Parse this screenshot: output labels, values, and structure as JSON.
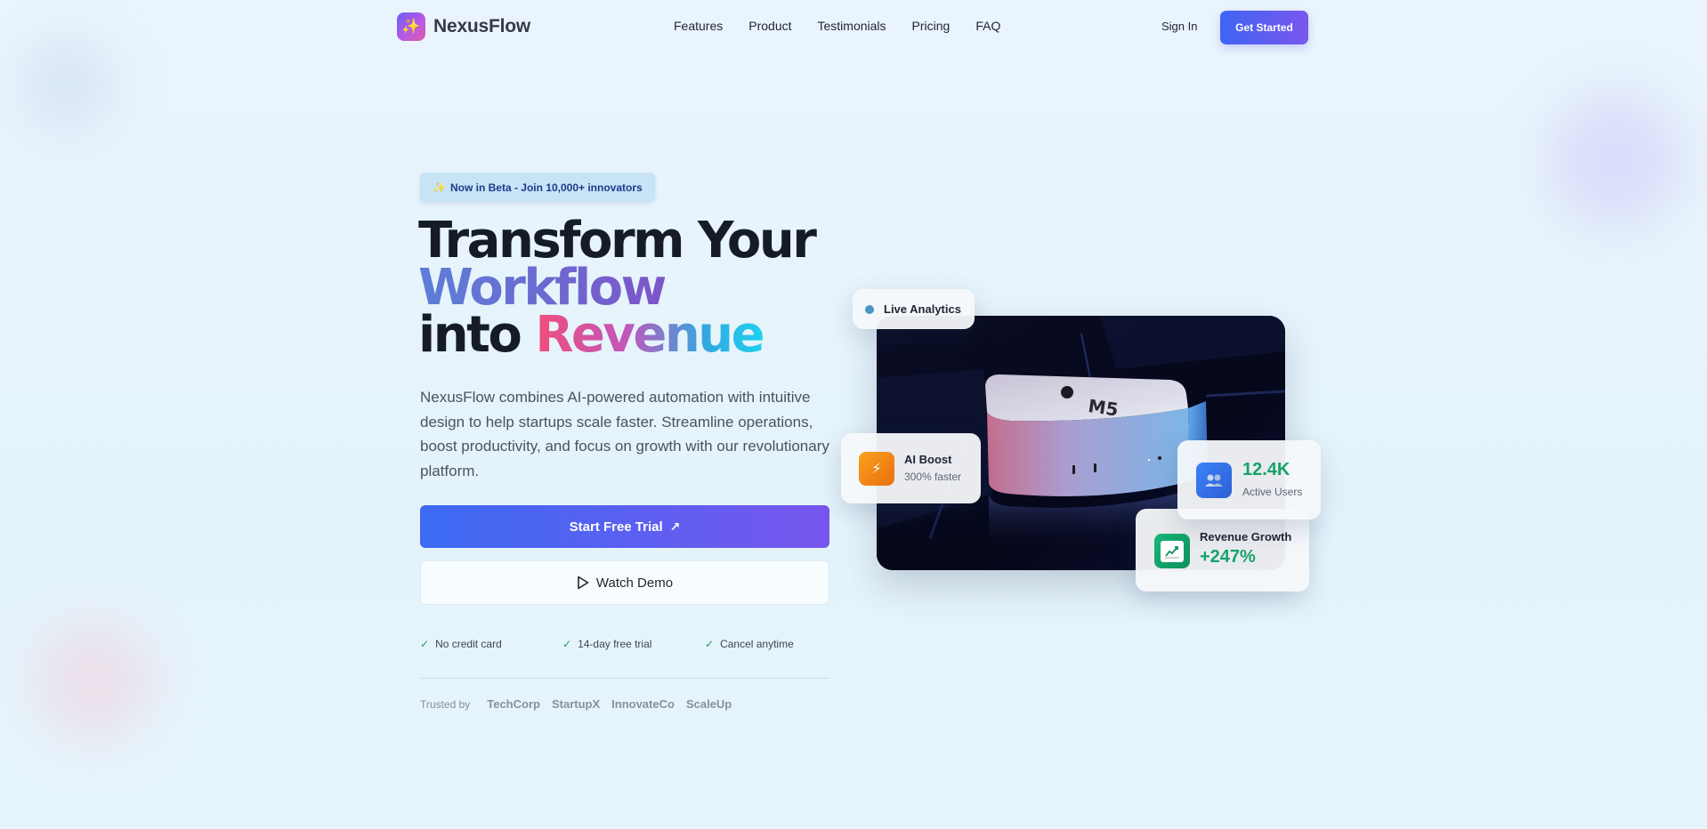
{
  "brand": {
    "name": "NexusFlow",
    "logo_icon": "sparkles-icon",
    "accent_color": "#4f63f0"
  },
  "nav": {
    "links": [
      "Features",
      "Product",
      "Testimonials",
      "Pricing",
      "FAQ"
    ],
    "sign_in": "Sign In",
    "cta": "Get Started"
  },
  "hero": {
    "badge": "Now in Beta - Join 10,000+ innovators",
    "badge_icon": "sparkles-icon",
    "headline": {
      "line1": "Transform Your",
      "line2": "Workflow",
      "line3_prefix": "into",
      "line3_highlight": "Revenue"
    },
    "description": "NexusFlow combines AI-powered automation with intuitive design to help startups scale faster. Streamline operations, boost productivity, and focus on growth with our revolutionary platform.",
    "primary_button": "Start Free Trial",
    "primary_button_icon": "arrow-up-right-icon",
    "secondary_button": "Watch Demo",
    "secondary_button_icon": "play-icon",
    "checks": [
      "No credit card",
      "14-day free trial",
      "Cancel anytime"
    ],
    "trusted_label": "Trusted by",
    "trusted_brands": [
      "TechCorp",
      "StartupX",
      "InnovateCo",
      "ScaleUp"
    ]
  },
  "visual": {
    "live_label": "Live Analytics",
    "ai_boost": {
      "title": "AI Boost",
      "subtitle": "300% faster",
      "icon": "lightning-icon"
    },
    "active_users": {
      "value": "12.4K",
      "label": "Active Users",
      "icon": "users-icon"
    },
    "revenue_growth": {
      "label": "Revenue Growth",
      "value": "+247%",
      "icon": "chart-up-icon"
    },
    "device_label": "M5"
  }
}
